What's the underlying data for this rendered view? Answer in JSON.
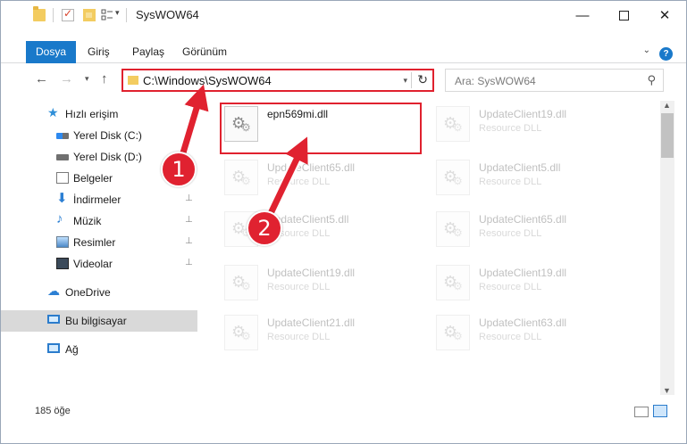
{
  "window": {
    "title": "SysWOW64",
    "min_glyph": "—",
    "close_glyph": "✕"
  },
  "ribbon": {
    "tabs": [
      {
        "label": "Dosya"
      },
      {
        "label": "Giriş"
      },
      {
        "label": "Paylaş"
      },
      {
        "label": "Görünüm"
      }
    ],
    "help_glyph": "?",
    "expand_glyph": "⌄"
  },
  "navigation": {
    "back_glyph": "←",
    "forward_glyph": "→",
    "recent_glyph": "▾",
    "up_glyph": "↑"
  },
  "address": {
    "path": "C:\\Windows\\SysWOW64",
    "dropdown_glyph": "▾",
    "refresh_glyph": "↻"
  },
  "search": {
    "placeholder": "Ara: SysWOW64",
    "icon_glyph": "⚲"
  },
  "sidebar": {
    "quick_access": "Hızlı erişim",
    "items": [
      {
        "label": "Yerel Disk (C:)",
        "icon": "drive-icon",
        "pinned": false
      },
      {
        "label": "Yerel Disk (D:)",
        "icon": "drive-icon",
        "pinned": true
      },
      {
        "label": "Belgeler",
        "icon": "documents-icon",
        "pinned": true
      },
      {
        "label": "İndirmeler",
        "icon": "downloads-icon",
        "pinned": true
      },
      {
        "label": "Müzik",
        "icon": "music-icon",
        "pinned": true
      },
      {
        "label": "Resimler",
        "icon": "pictures-icon",
        "pinned": true
      },
      {
        "label": "Videolar",
        "icon": "videos-icon",
        "pinned": true
      }
    ],
    "onedrive": "OneDrive",
    "this_pc": "Bu bilgisayar",
    "network": "Ağ",
    "pin_glyph": "📌"
  },
  "files": [
    {
      "name": "epn569mi.dll",
      "type": ""
    },
    {
      "name": "UpdateClient19.dll",
      "type": "Resource DLL"
    },
    {
      "name": "UpdateClient65.dll",
      "type": "Resource DLL"
    },
    {
      "name": "UpdateClient5.dll",
      "type": "Resource DLL"
    },
    {
      "name": "UpdateClient5.dll",
      "type": "Resource DLL"
    },
    {
      "name": "UpdateClient65.dll",
      "type": "Resource DLL"
    },
    {
      "name": "UpdateClient19.dll",
      "type": "Resource DLL"
    },
    {
      "name": "UpdateClient19.dll",
      "type": "Resource DLL"
    },
    {
      "name": "UpdateClient21.dll",
      "type": "Resource DLL"
    },
    {
      "name": "UpdateClient63.dll",
      "type": "Resource DLL"
    }
  ],
  "status": {
    "item_count": "185 öğe"
  },
  "annotations": {
    "step1": "1",
    "step2": "2",
    "color": "#e02230"
  },
  "colors": {
    "accent": "#1979ca",
    "highlight_border": "#e0212e"
  }
}
